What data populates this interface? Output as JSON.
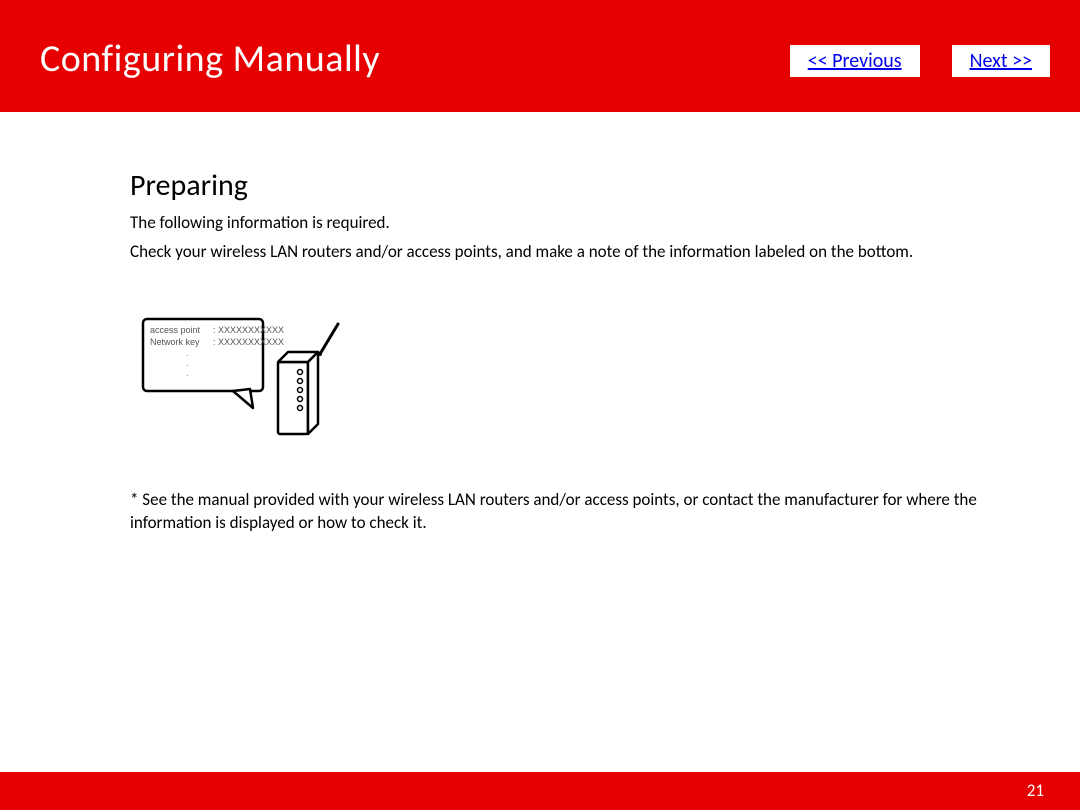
{
  "header": {
    "title": "Configuring Manually",
    "previous_label": "<< Previous",
    "next_label": "Next >>"
  },
  "content": {
    "section_heading": "Preparing",
    "intro_line1": "The following information is required.",
    "intro_line2": "Check your wireless LAN routers and/or access points, and make a note of the information labeled on the bottom.",
    "illustration_label_1": "access point",
    "illustration_value_1": ": XXXXXXXXXXX",
    "illustration_label_2": "Network key",
    "illustration_value_2": ": XXXXXXXXXXX",
    "footnote": "* See the manual provided with your wireless LAN routers and/or access points, or contact the manufacturer for where the information is displayed or how to check it."
  },
  "footer": {
    "page_number": "21"
  }
}
